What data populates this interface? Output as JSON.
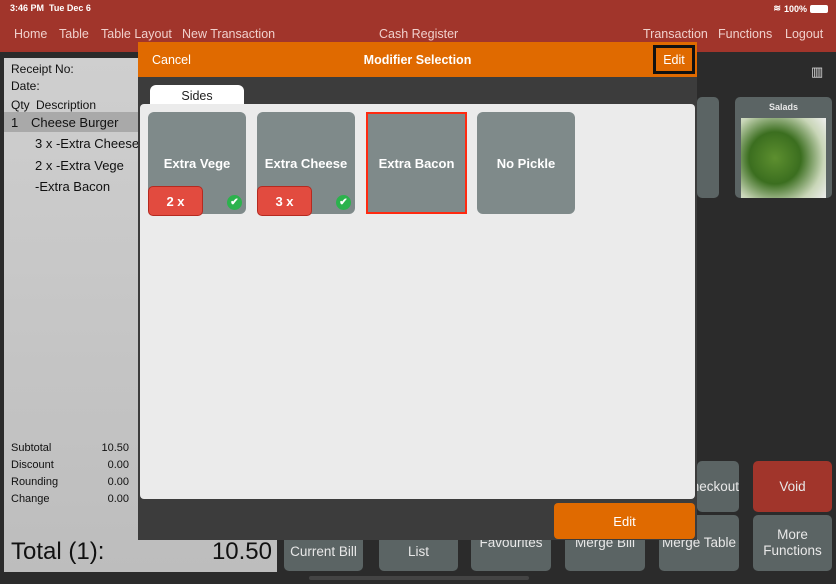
{
  "status": {
    "time": "3:46 PM",
    "date": "Tue Dec 6",
    "battery": "100%"
  },
  "nav": {
    "left": [
      "Home",
      "Table",
      "Table Layout",
      "New Transaction"
    ],
    "title": "Cash Register",
    "right": [
      "Transaction",
      "Functions",
      "Logout"
    ]
  },
  "receipt": {
    "receipt_no": "Receipt No:",
    "date": "Date:",
    "qty_header": "Qty",
    "desc_header": "Description",
    "items": [
      {
        "qty": "1",
        "desc": "Cheese Burger"
      },
      {
        "qty": "",
        "desc": "3 x -Extra Cheese"
      },
      {
        "qty": "",
        "desc": "2 x -Extra Vege"
      },
      {
        "qty": "",
        "desc": "-Extra Bacon"
      }
    ],
    "summary": [
      {
        "label": "Subtotal",
        "value": "10.50"
      },
      {
        "label": "Discount",
        "value": "0.00"
      },
      {
        "label": "Rounding",
        "value": "0.00"
      },
      {
        "label": "Change",
        "value": "0.00"
      }
    ],
    "total_label": "Total (1):",
    "total_value": "10.50"
  },
  "background": {
    "category": "Salads",
    "checkout": "Checkout",
    "void": "Void",
    "buttons": [
      "Current Bill",
      "List",
      "Favourites",
      "Merge Bill",
      "Merge Table",
      "More Functions"
    ]
  },
  "modal": {
    "cancel": "Cancel",
    "title": "Modifier Selection",
    "edit": "Edit",
    "tab": "Sides",
    "modifiers": [
      {
        "name": "Extra Vege",
        "qty": "2 x",
        "checked": true
      },
      {
        "name": "Extra Cheese",
        "qty": "3 x",
        "checked": true
      },
      {
        "name": "Extra Bacon",
        "selected": true
      },
      {
        "name": "No Pickle"
      }
    ],
    "edit_bottom": "Edit"
  },
  "colors": {
    "topbar": "#a1352b",
    "accent": "#e06a00",
    "void": "#a1352b",
    "check": "#2cb24d",
    "qty_badge": "#e24b3f"
  }
}
